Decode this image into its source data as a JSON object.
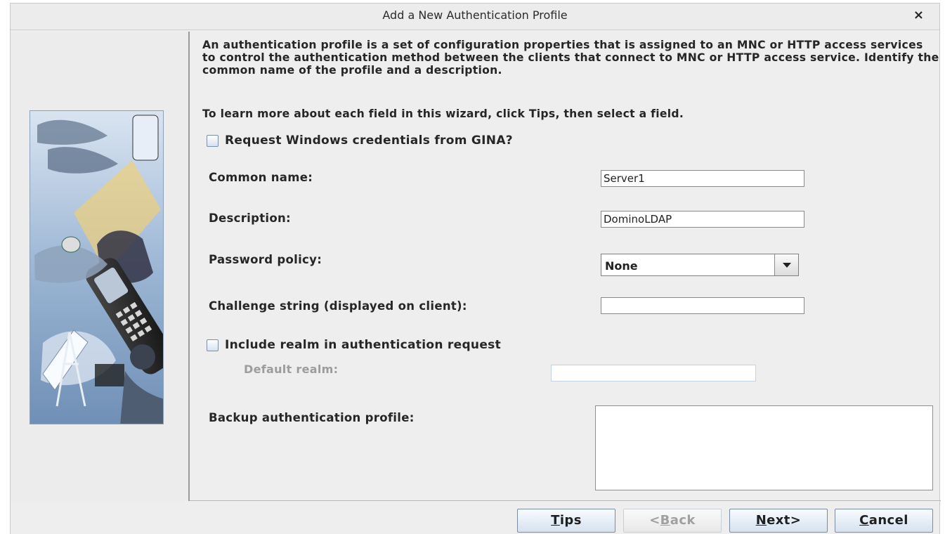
{
  "window": {
    "title": "Add a New Authentication Profile",
    "close_label": "×"
  },
  "intro": {
    "description": "An authentication profile is a set of configuration properties that is assigned to an MNC or HTTP access services to control the authentication method between the clients that connect to MNC or HTTP access service. Identify the common name of the profile and a description.",
    "tip": "To learn more about each field in this wizard, click Tips, then select a field."
  },
  "form": {
    "gina_label": "Request Windows credentials from GINA?",
    "common_name_label": "Common name:",
    "common_name_value": "Server1",
    "description_label": "Description:",
    "description_value": "DominoLDAP",
    "password_policy_label": "Password policy:",
    "password_policy_value": "None",
    "challenge_label": "Challenge string (displayed on client):",
    "challenge_value": "",
    "include_realm_label": "Include realm in authentication request",
    "default_realm_label": "Default realm:",
    "default_realm_value": "",
    "backup_label": "Backup authentication profile:"
  },
  "buttons": {
    "tips": {
      "first": "T",
      "rest": "ips"
    },
    "back": {
      "prefix": "<",
      "first": "B",
      "rest": "ack"
    },
    "next": {
      "first": "N",
      "rest": "ext>"
    },
    "cancel": {
      "first": "C",
      "rest": "ancel"
    }
  }
}
